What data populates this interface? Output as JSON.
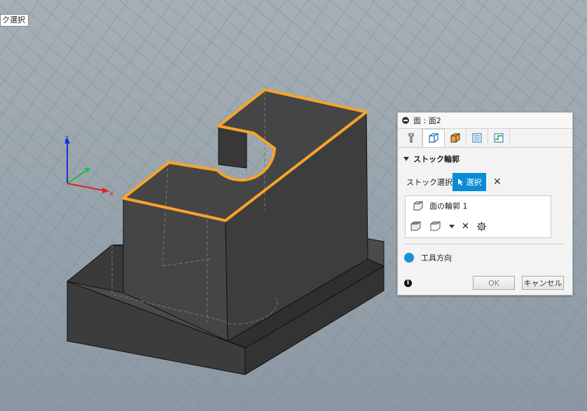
{
  "tooltip": "ク選択",
  "axes": {
    "z": "Z",
    "x": "X"
  },
  "colors": {
    "grid_bg": "#95a2ab",
    "grid_line": "#8694a0",
    "model_fill": "#3a3a3a",
    "highlight": "#f7a32b",
    "accent": "#0a8bd6"
  },
  "dialog": {
    "title": "面 : 面2",
    "tabs": [
      {
        "icon": "tool-icon",
        "active": false
      },
      {
        "icon": "geometry-icon",
        "active": true
      },
      {
        "icon": "heights-icon",
        "active": false
      },
      {
        "icon": "passes-icon",
        "active": false
      },
      {
        "icon": "linking-icon",
        "active": false
      }
    ],
    "section": "ストック輪郭",
    "stock_label": "ストック選択",
    "select_label": "選択",
    "list_item": "面の輪郭 1",
    "tool_direction": "工具方向",
    "ok": "OK",
    "cancel": "キャンセル"
  }
}
